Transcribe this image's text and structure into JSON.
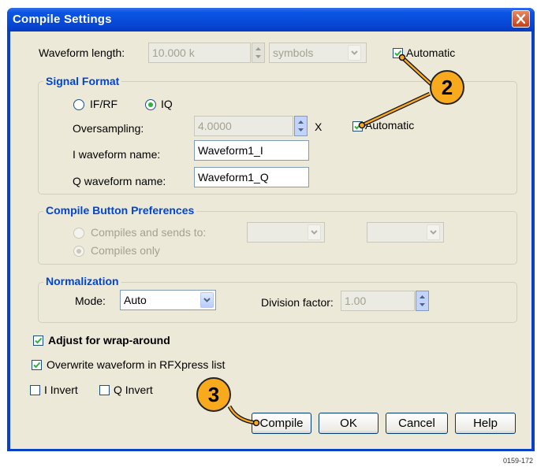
{
  "window": {
    "title": "Compile Settings"
  },
  "waveform": {
    "length_label": "Waveform length:",
    "length_value": "10.000 k",
    "units_value": "symbols",
    "automatic_label": "Automatic"
  },
  "signal_format": {
    "title": "Signal Format",
    "radio_ifrf": "IF/RF",
    "radio_iq": "IQ",
    "oversampling_label": "Oversampling:",
    "oversampling_value": "4.0000",
    "x_label": "X",
    "automatic_label": "Automatic",
    "i_name_label": "I waveform name:",
    "i_name_value": "Waveform1_I",
    "q_name_label": "Q waveform name:",
    "q_name_value": "Waveform1_Q"
  },
  "compile_prefs": {
    "title": "Compile Button Preferences",
    "compiles_sends_label": "Compiles and sends to:",
    "compiles_only_label": "Compiles only"
  },
  "normalization": {
    "title": "Normalization",
    "mode_label": "Mode:",
    "mode_value": "Auto",
    "division_label": "Division factor:",
    "division_value": "1.00"
  },
  "options": {
    "wrap_label": "Adjust for wrap-around",
    "overwrite_label": "Overwrite waveform in RFXpress list",
    "i_invert_label": "I Invert",
    "q_invert_label": "Q Invert"
  },
  "buttons": {
    "compile": "Compile",
    "ok": "OK",
    "cancel": "Cancel",
    "help": "Help"
  },
  "callouts": {
    "c2": "2",
    "c3": "3"
  },
  "figure_id": "0159-172",
  "colors": {
    "titlebar": "#0747d6",
    "group_title": "#0046d5",
    "callout": "#f8aa1c",
    "check": "#2bb43a"
  }
}
